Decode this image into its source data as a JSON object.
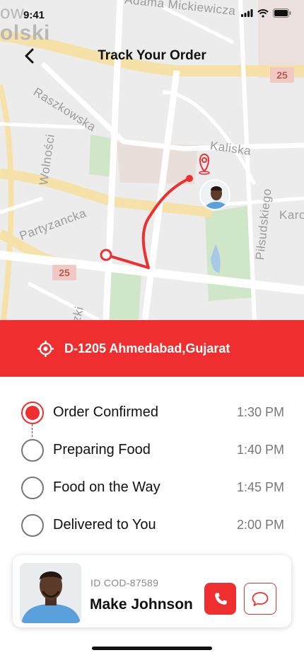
{
  "status_bar": {
    "time": "9:41"
  },
  "header": {
    "title": "Track Your Order",
    "back_icon": "chevron-left-icon"
  },
  "map": {
    "streets": [
      "Adama Mickiewicza",
      "olski",
      "Raszkowska",
      "Wolności",
      "Partyzancka",
      "Kaliska",
      "Piłsudskiego",
      "Karo",
      "ow",
      "zki"
    ],
    "road_badges": [
      "25",
      "25"
    ],
    "route_color": "#ef2f2f"
  },
  "address": {
    "icon": "crosshair-location-icon",
    "text": "D-1205 Ahmedabad,Gujarat"
  },
  "steps": [
    {
      "label": "Order Confirmed",
      "time": "1:30 PM",
      "active": true
    },
    {
      "label": "Preparing Food",
      "time": "1:40 PM",
      "active": false
    },
    {
      "label": "Food on the Way",
      "time": "1:45 PM",
      "active": false
    },
    {
      "label": "Delivered to You",
      "time": "2:00 PM",
      "active": false
    }
  ],
  "driver": {
    "order_id": "ID COD-87589",
    "name": "Make Johnson",
    "call_icon": "phone-icon",
    "chat_icon": "chat-bubble-icon"
  },
  "colors": {
    "accent": "#ef2f2f",
    "map_bg": "#ececec",
    "park": "#cfe6c8",
    "highway": "#f6e2a8"
  }
}
